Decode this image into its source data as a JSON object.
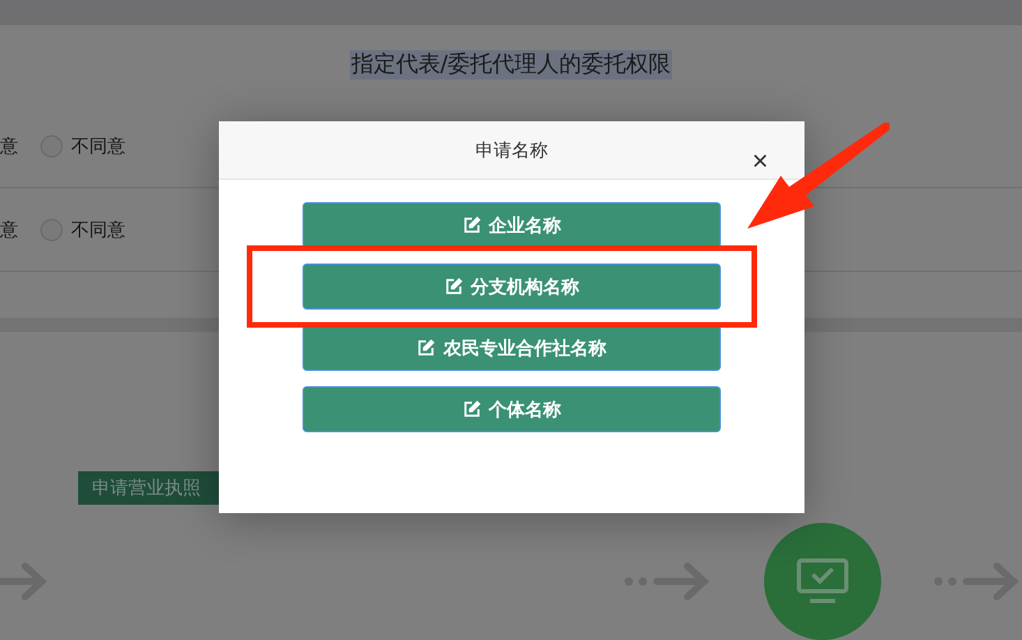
{
  "page": {
    "section_title": "指定代表/委托代理人的委托权限",
    "rows": [
      {
        "cut_label": "意",
        "option": "不同意",
        "checked": false
      },
      {
        "cut_label": "意",
        "option": "不同意",
        "checked": false
      }
    ],
    "license_button": "申请营业执照"
  },
  "dialog": {
    "title": "申请名称",
    "close": "×",
    "options": [
      {
        "label": "企业名称",
        "highlighted": false
      },
      {
        "label": "分支机构名称",
        "highlighted": true
      },
      {
        "label": "农民专业合作社名称",
        "highlighted": false
      },
      {
        "label": "个体名称",
        "highlighted": false
      }
    ]
  }
}
